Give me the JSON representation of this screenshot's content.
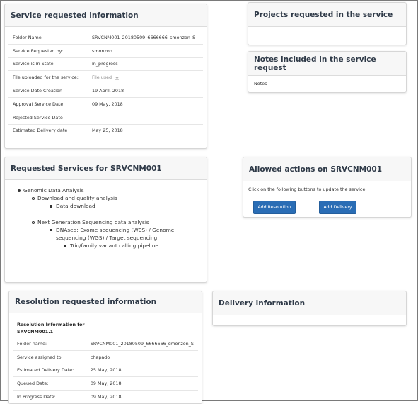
{
  "service_info": {
    "title": "Service requested information",
    "rows": [
      {
        "label": "Folder Name",
        "value": "SRVCNM001_20180509_6666666_smonzon_S"
      },
      {
        "label": "Service Requested by:",
        "value": "smonzon"
      },
      {
        "label": "Service is in State:",
        "value": "in_progress"
      },
      {
        "label": "File uploaded for the service:",
        "value": "File used"
      },
      {
        "label": "Service Date Creation",
        "value": "19 April, 2018"
      },
      {
        "label": "Approval Service Date",
        "value": "09 May, 2018"
      },
      {
        "label": "Rejected Service Date",
        "value": "--"
      },
      {
        "label": "Estimated Delivery date",
        "value": "May 25, 2018"
      }
    ],
    "file_icon": "download-icon"
  },
  "projects": {
    "title": "Projects requested in the service"
  },
  "notes": {
    "title": "Notes included in the service request",
    "text": "Notes"
  },
  "requested_services": {
    "title": "Requested Services for SRVCNM001",
    "tree": {
      "l1_a": "Genomic Data Analysis",
      "l2_a": "Download and quality analysis",
      "l3_a": "Data download",
      "l2_b": "Next Generation Sequencing data analysis",
      "l3_b": "DNAseq: Exome sequencing (WES) / Genome sequencing (WGS) / Target sequencing",
      "l4_b": "Trio/family variant calling pipeline"
    }
  },
  "actions": {
    "title": "Allowed actions on SRVCNM001",
    "hint": "Click on the following buttons to update the service",
    "add_resolution": "Add Resolution",
    "add_delivery": "Add Delivery",
    "button_color": "#2a6db5"
  },
  "resolution": {
    "title": "Resolution requested information",
    "subtitle": "Resolution Information for SRVCNM001.1",
    "rows": [
      {
        "label": "Folder name:",
        "value": "SRVCNM001_20180509_6666666_smonzon_S"
      },
      {
        "label": "Service assigned to:",
        "value": "chapado"
      },
      {
        "label": "Estimated Delivery Date:",
        "value": "25 May, 2018"
      },
      {
        "label": "Queued Date:",
        "value": "09 May, 2018"
      },
      {
        "label": "In Progress Date:",
        "value": "09 May, 2018"
      }
    ]
  },
  "delivery": {
    "title": "Delivery information"
  }
}
